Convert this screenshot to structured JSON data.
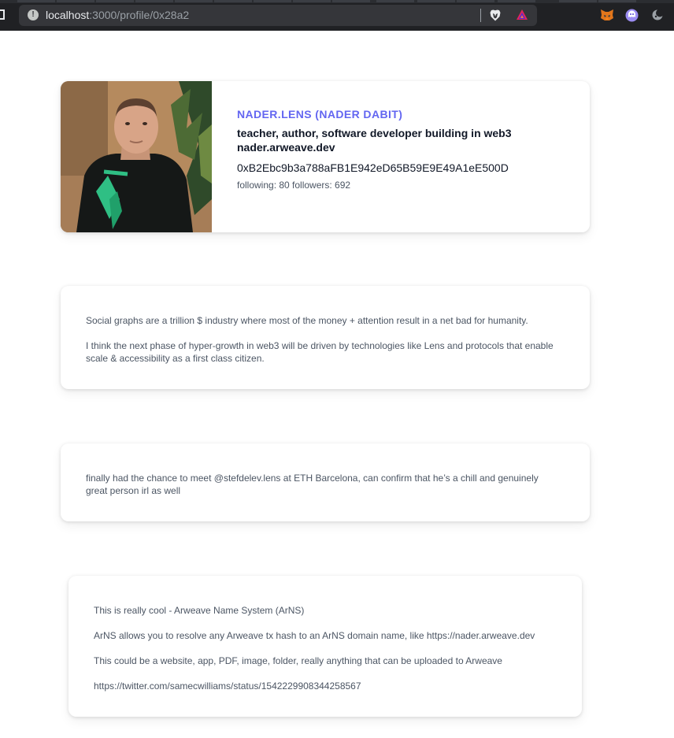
{
  "browser": {
    "url_host": "localhost",
    "url_path": ":3000/profile/0x28a2",
    "info_icon": "!",
    "brave_icon": "brave-lion-icon",
    "rewards_icon": "brave-rewards-icon",
    "extensions": [
      "metamask-fox-icon",
      "ghost-extension-icon",
      "dark-mode-moon-icon"
    ]
  },
  "profile": {
    "name": "NADER.LENS (NADER DABIT)",
    "bio": "teacher, author, software developer building in web3 nader.arweave.dev",
    "address": "0xB2Ebc9b3a788aFB1E942eD65B59E9E49A1eE500D",
    "stats": "following: 80 followers: 692",
    "accent_color": "#6366f1"
  },
  "posts": [
    {
      "paragraphs": [
        "Social graphs are a trillion $ industry where most of the money + attention result in a net bad for humanity.",
        "I think the next phase of hyper-growth in web3 will be driven by technologies like Lens and protocols that enable scale & accessibility as a first class citizen."
      ]
    },
    {
      "paragraphs": [
        "finally had the chance to meet @stefdelev.lens at ETH Barcelona, can confirm that he’s a chill and genuinely great person irl as well"
      ]
    },
    {
      "paragraphs": [
        "This is really cool - Arweave Name System (ArNS)",
        "ArNS allows you to resolve any Arweave tx hash to an ArNS domain name, like https://nader.arweave.dev",
        "This could be a website, app, PDF, image, folder, really anything that can be uploaded to Arweave",
        "https://twitter.com/samecwilliams/status/1542229908344258567"
      ]
    }
  ]
}
